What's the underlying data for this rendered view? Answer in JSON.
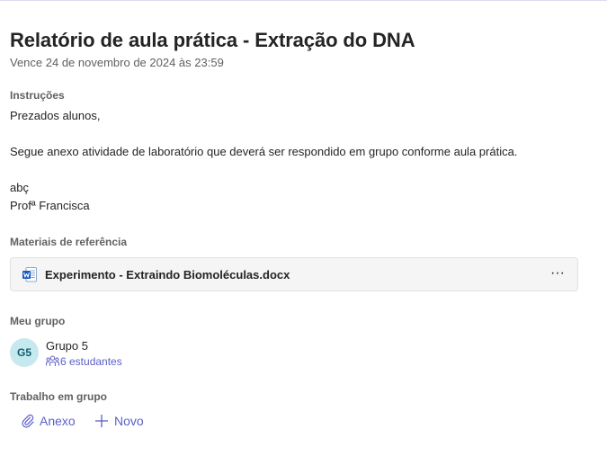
{
  "assignment": {
    "title": "Relatório de aula prática - Extração do DNA",
    "due": "Vence 24 de novembro de 2024 às 23:59"
  },
  "instructions": {
    "label": "Instruções",
    "lines": [
      "Prezados alunos,",
      "Segue anexo atividade de laboratório que deverá ser respondido em grupo conforme aula prática.",
      "abç",
      "Profª Francisca"
    ]
  },
  "reference": {
    "label": "Materiais de referência",
    "file": {
      "name": "Experimento - Extraindo Biomoléculas.docx",
      "icon": "word-doc-icon",
      "more": "···"
    }
  },
  "group": {
    "label": "Meu grupo",
    "avatar": "G5",
    "name": "Grupo 5",
    "members": "6 estudantes"
  },
  "group_work": {
    "label": "Trabalho em grupo",
    "attach_label": "Anexo",
    "new_label": "Novo"
  },
  "colors": {
    "accent": "#5b5fc7",
    "avatar_bg": "#c6e9ef",
    "word_blue": "#185abd"
  }
}
